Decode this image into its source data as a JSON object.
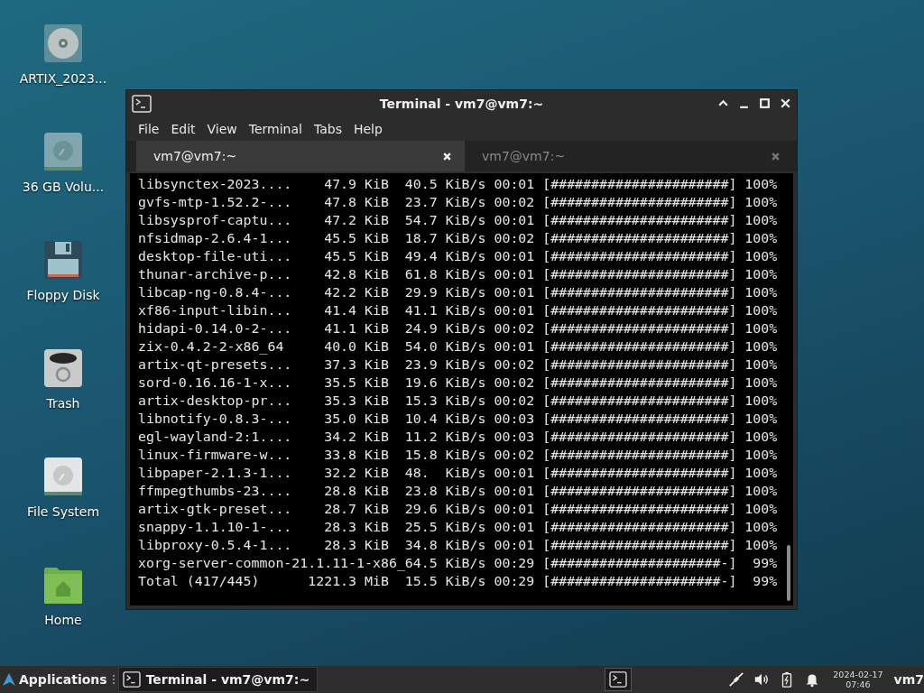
{
  "desktop_icons": [
    {
      "label": "ARTIX_2023...",
      "kind": "dvd"
    },
    {
      "label": "36 GB Volu...",
      "kind": "drive"
    },
    {
      "label": "Floppy Disk",
      "kind": "floppy"
    },
    {
      "label": "Trash",
      "kind": "trash"
    },
    {
      "label": "File System",
      "kind": "filesystem"
    },
    {
      "label": "Home",
      "kind": "home"
    }
  ],
  "window": {
    "title": "Terminal - vm7@vm7:~",
    "menu": [
      "File",
      "Edit",
      "View",
      "Terminal",
      "Tabs",
      "Help"
    ],
    "tabs": [
      {
        "label": "vm7@vm7:~",
        "selected": true
      },
      {
        "label": "vm7@vm7:~",
        "selected": false
      }
    ],
    "lines": [
      "libsynctex-2023....    47.9 KiB  40.5 KiB/s 00:01 [######################] 100%",
      "gvfs-mtp-1.52.2-...    47.8 KiB  23.7 KiB/s 00:02 [######################] 100%",
      "libsysprof-captu...    47.2 KiB  54.7 KiB/s 00:01 [######################] 100%",
      "nfsidmap-2.6.4-1...    45.5 KiB  18.7 KiB/s 00:02 [######################] 100%",
      "desktop-file-uti...    45.5 KiB  49.4 KiB/s 00:01 [######################] 100%",
      "thunar-archive-p...    42.8 KiB  61.8 KiB/s 00:01 [######################] 100%",
      "libcap-ng-0.8.4-...    42.2 KiB  29.9 KiB/s 00:01 [######################] 100%",
      "xf86-input-libin...    41.4 KiB  41.1 KiB/s 00:01 [######################] 100%",
      "hidapi-0.14.0-2-...    41.1 KiB  24.9 KiB/s 00:02 [######################] 100%",
      "zix-0.4.2-2-x86_64     40.0 KiB  54.0 KiB/s 00:01 [######################] 100%",
      "artix-qt-presets...    37.3 KiB  23.9 KiB/s 00:02 [######################] 100%",
      "sord-0.16.16-1-x...    35.5 KiB  19.6 KiB/s 00:02 [######################] 100%",
      "artix-desktop-pr...    35.3 KiB  15.3 KiB/s 00:02 [######################] 100%",
      "libnotify-0.8.3-...    35.0 KiB  10.4 KiB/s 00:03 [######################] 100%",
      "egl-wayland-2:1....    34.2 KiB  11.2 KiB/s 00:03 [######################] 100%",
      "linux-firmware-w...    33.8 KiB  15.8 KiB/s 00:02 [######################] 100%",
      "libpaper-2.1.3-1...    32.2 KiB  48.  KiB/s 00:01 [######################] 100%",
      "ffmpegthumbs-23....    28.8 KiB  23.8 KiB/s 00:01 [######################] 100%",
      "artix-gtk-preset...    28.7 KiB  29.6 KiB/s 00:01 [######################] 100%",
      "snappy-1.1.10-1-...    28.3 KiB  25.5 KiB/s 00:01 [######################] 100%",
      "libproxy-0.5.4-1...    28.3 KiB  34.8 KiB/s 00:01 [######################] 100%",
      "xorg-server-common-21.1.11-1-x86_64.5 KiB/s 00:29 [#####################-]  99%",
      "Total (417/445)      1221.3 MiB  15.5 KiB/s 00:29 [#####################-]  99%"
    ]
  },
  "taskbar": {
    "applications": "Applications",
    "tasks": [
      {
        "label": "Terminal - vm7@vm7:~",
        "selected": true
      }
    ],
    "date": "2024-02-17",
    "time": "07:46",
    "user": "vm7"
  }
}
